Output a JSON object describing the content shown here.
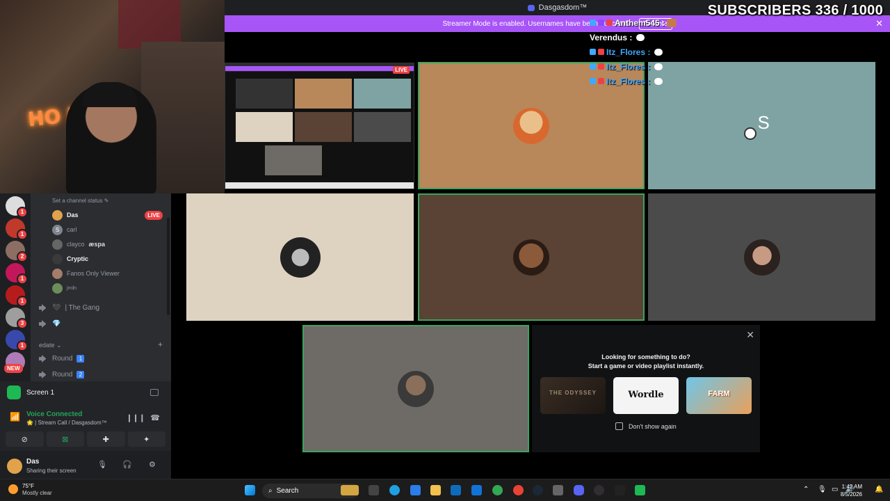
{
  "window": {
    "title": "Dasgasdom™",
    "subscribers": "SUBSCRIBERS 336 / 1000"
  },
  "banner": {
    "text": "Streamer Mode is enabled. Usernames have been truncated.",
    "button": "Disable",
    "close": "✕"
  },
  "chat": [
    {
      "name": "Anthem545 :"
    },
    {
      "name": "Verendus :"
    },
    {
      "name": "Itz_Flores :"
    },
    {
      "name": "Itz_Flores :"
    },
    {
      "name": "Itz_Flores :"
    }
  ],
  "stream_preview": {
    "live": "LIVE"
  },
  "tiles": {
    "s_initial": "S"
  },
  "sidebar": {
    "status_hint": "Set a channel status ✎",
    "users": [
      {
        "name": "Das",
        "live": "LIVE"
      },
      {
        "name": "carl",
        "initial": "S"
      },
      {
        "name": "clayco",
        "tag": "æspa"
      },
      {
        "name": "Cryptic"
      },
      {
        "name": "Fanos Only Viewer"
      },
      {
        "name": "jrrdn"
      }
    ],
    "channels": [
      {
        "label": "| The Gang",
        "prefix": "🖤"
      },
      {
        "label": "",
        "prefix": "💎"
      }
    ],
    "category": "edate ⌄",
    "category_add": "+",
    "rounds": [
      {
        "label": "Round",
        "num": "1"
      },
      {
        "label": "Round",
        "num": "2"
      }
    ],
    "new_badge": "NEW",
    "server_counts": [
      "1",
      "1",
      "2",
      "1",
      "1",
      "3",
      "1"
    ]
  },
  "panel": {
    "screen_label": "Screen 1",
    "voice_status": "Voice Connected",
    "voice_sub": "🌟 | Stream Call / Dasgasdom™",
    "user": {
      "name": "Das",
      "status": "Sharing their screen"
    }
  },
  "activity": {
    "close": "✕",
    "line1": "Looking for something to do?",
    "line2": "Start a game or video playlist instantly.",
    "cards": [
      {
        "label": "THE ODYSSEY"
      },
      {
        "label": "Wordle"
      },
      {
        "label": "FARM"
      }
    ],
    "dont_show": "Don't show again"
  },
  "taskbar": {
    "temp": "75°F",
    "weather": "Mostly clear",
    "search": "Search",
    "time": "1:42 AM",
    "date": "8/5/2026"
  }
}
